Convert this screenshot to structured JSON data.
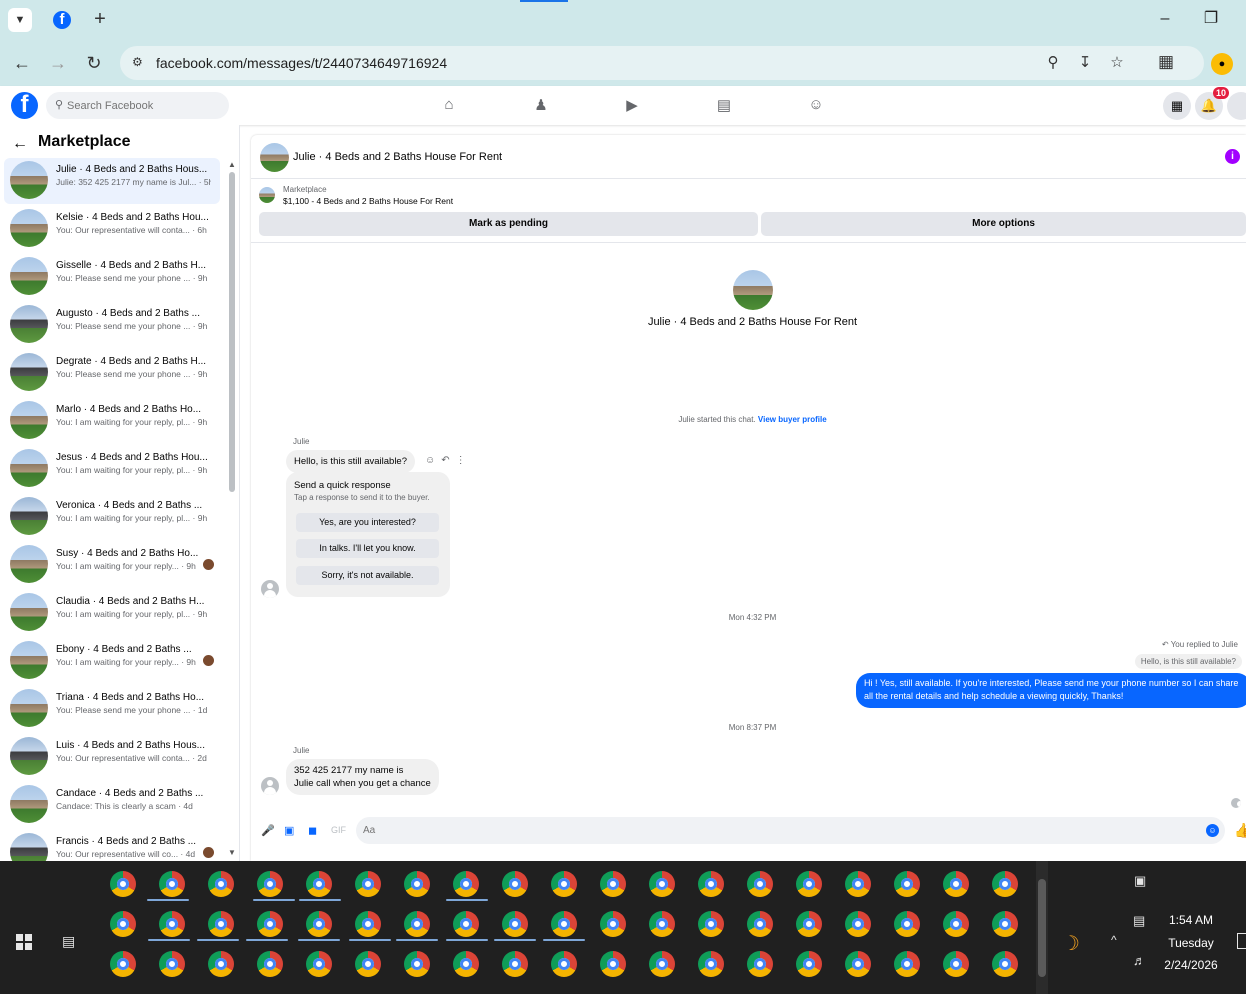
{
  "browser": {
    "tab_dropdown_icon": "chevron-down-icon",
    "new_tab_label": "+",
    "url": "facebook.com/messages/t/2440734649716924",
    "accent": "#cfe8ea"
  },
  "fb": {
    "search_placeholder": "Search Facebook",
    "notification_count": "10",
    "brand": "#0866ff"
  },
  "sidebar": {
    "title": "Marketplace",
    "conversations": [
      {
        "title": "Julie · 4 Beds and 2 Baths Hous...",
        "preview": "Julie: 352 425 2177 my name is Jul... · 5h",
        "active": true,
        "dark": false
      },
      {
        "title": "Kelsie · 4 Beds and 2 Baths Hou...",
        "preview": "You: Our representative will conta... · 6h",
        "dark": false
      },
      {
        "title": "Gisselle · 4 Beds and 2 Baths H...",
        "preview": "You: Please send me your phone ... · 9h",
        "dark": false
      },
      {
        "title": "Augusto · 4 Beds and 2 Baths ...",
        "preview": "You: Please send me your phone ... · 9h",
        "dark": true
      },
      {
        "title": "Degrate · 4 Beds and 2 Baths H...",
        "preview": "You: Please send me your phone ... · 9h",
        "dark": true
      },
      {
        "title": "Marlo · 4 Beds and 2 Baths Ho...",
        "preview": "You: I am waiting for your reply, pl... · 9h",
        "dark": false
      },
      {
        "title": "Jesus · 4 Beds and 2 Baths Hou...",
        "preview": "You: I am waiting for your reply, pl... · 9h",
        "dark": false
      },
      {
        "title": "Veronica · 4 Beds and 2 Baths ...",
        "preview": "You: I am waiting for your reply, pl... · 9h",
        "dark": true
      },
      {
        "title": "Susy · 4 Beds and 2 Baths Ho...",
        "preview": "You: I am waiting for your reply... · 9h",
        "dark": false,
        "mini": true
      },
      {
        "title": "Claudia · 4 Beds and 2 Baths H...",
        "preview": "You: I am waiting for your reply, pl... · 9h",
        "dark": false
      },
      {
        "title": "Ebony · 4 Beds and 2 Baths ...",
        "preview": "You: I am waiting for your reply... · 9h",
        "dark": false,
        "mini": true
      },
      {
        "title": "Triana · 4 Beds and 2 Baths Ho...",
        "preview": "You: Please send me your phone ... · 1d",
        "dark": false
      },
      {
        "title": "Luis · 4 Beds and 2 Baths Hous...",
        "preview": "You: Our representative will conta... · 2d",
        "dark": true
      },
      {
        "title": "Candace · 4 Beds and 2 Baths ...",
        "preview": "Candace: This is clearly a scam · 4d",
        "dark": false
      },
      {
        "title": "Francis · 4 Beds and 2 Baths ...",
        "preview": "You: Our representative will co... · 4d",
        "dark": true,
        "mini": true
      }
    ]
  },
  "chat": {
    "header_title": "Julie · 4 Beds and 2 Baths House For Rent",
    "marketplace_label": "Marketplace",
    "listing": "$1,100 - 4 Beds and 2 Baths House For Rent",
    "mark_pending": "Mark as pending",
    "more_options": "More options",
    "profile_title": "Julie · 4 Beds and 2 Baths House For Rent",
    "started_text": "Julie started this chat. ",
    "buyer_profile_link": "View buyer profile",
    "sender_name": "Julie",
    "first_message": "Hello, is this still available?",
    "quick_title": "Send a quick response",
    "quick_sub": "Tap a response to send it to the buyer.",
    "quick_options": [
      "Yes, are you interested?",
      "In talks. I'll let you know.",
      "Sorry, it's not available."
    ],
    "time1": "Mon 4:32 PM",
    "replied_to": "You replied to Julie",
    "replied_quote": "Hello, is this still available?",
    "outgoing": "Hi ! Yes, still available. If you're interested, Please send me your phone number so I can share all the rental details and help schedule a viewing quickly, Thanks!",
    "time2": "Mon 8:37 PM",
    "sender_name2": "Julie",
    "last_line1": "352 425 2177 my name is",
    "last_line2": "Julie call when you get a chance",
    "input_placeholder": "Aa"
  },
  "taskbar": {
    "time": "1:54 AM",
    "day": "Tuesday",
    "date": "2/24/2026"
  }
}
